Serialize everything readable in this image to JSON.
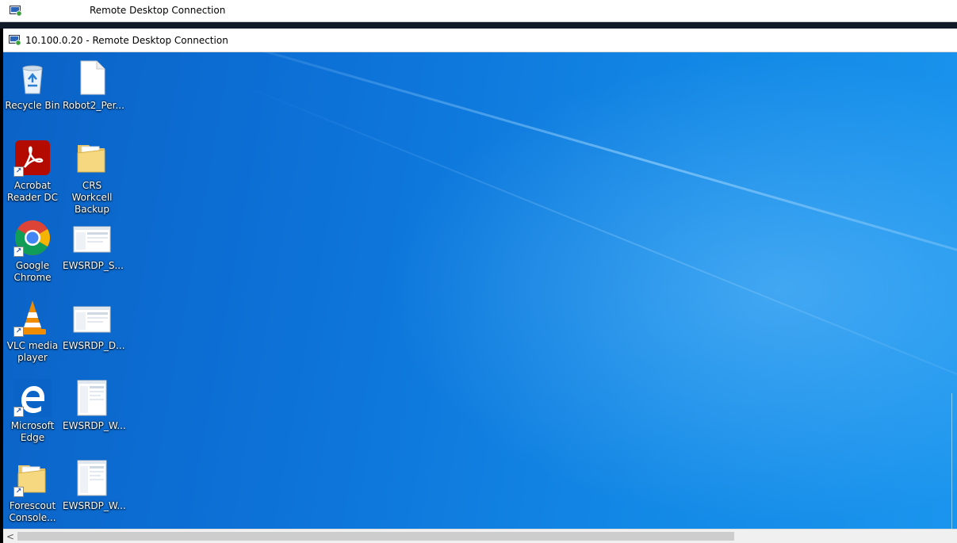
{
  "outer_window": {
    "title": "Remote Desktop Connection"
  },
  "inner_window": {
    "title": "10.100.0.20 - Remote Desktop Connection"
  },
  "desktop": {
    "icons": [
      {
        "label": "Recycle Bin",
        "icon": "recycle-bin-icon"
      },
      {
        "label": "Robot2_Per...",
        "icon": "blank-file-icon"
      },
      {
        "label": "Acrobat Reader DC",
        "icon": "acrobat-icon"
      },
      {
        "label": "CRS Workcell Backup",
        "icon": "folder-icon"
      },
      {
        "label": "Google Chrome",
        "icon": "chrome-icon"
      },
      {
        "label": "EWSRDP_S...",
        "icon": "screenshot-file-icon"
      },
      {
        "label": "VLC media player",
        "icon": "vlc-icon"
      },
      {
        "label": "EWSRDP_D...",
        "icon": "screenshot-file-icon"
      },
      {
        "label": "Microsoft Edge",
        "icon": "edge-icon"
      },
      {
        "label": "EWSRDP_W...",
        "icon": "screenshot-file-icon"
      },
      {
        "label": "Forescout Console...",
        "icon": "folder-icon"
      },
      {
        "label": "EWSRDP_W...",
        "icon": "screenshot-file-icon"
      }
    ]
  },
  "scrollbar": {
    "left_arrow": "<"
  },
  "colors": {
    "desktop_blue": "#0d73d9",
    "acrobat_red": "#b30b00",
    "edge_blue": "#0a64c8"
  }
}
